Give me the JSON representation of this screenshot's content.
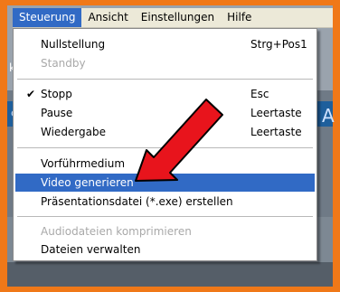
{
  "menubar": {
    "items": [
      "Steuerung",
      "Ansicht",
      "Einstellungen",
      "Hilfe"
    ]
  },
  "dropdown": {
    "items": [
      {
        "label": "Nullstellung",
        "shortcut": "Strg+Pos1",
        "disabled": false,
        "checked": false
      },
      {
        "label": "Standby",
        "shortcut": "",
        "disabled": true,
        "checked": false
      },
      {
        "label": "Stopp",
        "shortcut": "Esc",
        "disabled": false,
        "checked": true
      },
      {
        "label": "Pause",
        "shortcut": "Leertaste",
        "disabled": false,
        "checked": false
      },
      {
        "label": "Wiedergabe",
        "shortcut": "Leertaste",
        "disabled": false,
        "checked": false
      },
      {
        "label": "Vorführmedium",
        "shortcut": "",
        "disabled": false,
        "checked": false
      },
      {
        "label": "Video generieren",
        "shortcut": "",
        "disabled": false,
        "checked": false,
        "highlighted": true
      },
      {
        "label": "Präsentationsdatei (*.exe) erstellen",
        "shortcut": "",
        "disabled": false,
        "checked": false
      },
      {
        "label": "Audiodateien komprimieren",
        "shortcut": "",
        "disabled": true,
        "checked": false
      },
      {
        "label": "Dateien verwalten",
        "shortcut": "",
        "disabled": false,
        "checked": false
      }
    ],
    "check_glyph": "✔"
  },
  "background": {
    "edge_letters": [
      "k",
      "c",
      "A"
    ]
  },
  "colors": {
    "frame": "#f07818",
    "highlight": "#316ac5",
    "arrow": "#e8141c"
  },
  "annotation": {
    "icon": "red-arrow-icon"
  }
}
